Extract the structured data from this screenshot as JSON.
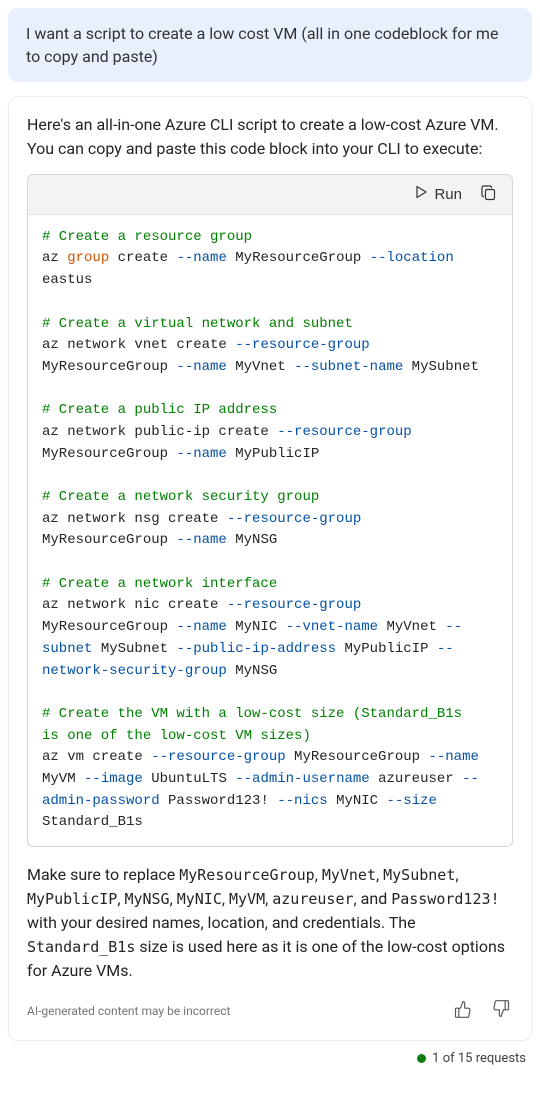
{
  "userMessage": "I want a script to create a low cost VM (all in one codeblock for me to copy and paste)",
  "responseIntro": "Here's an all-in-one Azure CLI script to create a low-cost Azure VM. You can copy and paste this code block into your CLI to execute:",
  "toolbar": {
    "runLabel": "Run"
  },
  "code": {
    "lines": [
      [
        {
          "t": "comment",
          "v": "# Create a resource group"
        }
      ],
      [
        {
          "t": "plain",
          "v": "az "
        },
        {
          "t": "keyword",
          "v": "group"
        },
        {
          "t": "plain",
          "v": " create "
        },
        {
          "t": "flag",
          "v": "--name"
        },
        {
          "t": "plain",
          "v": " MyResourceGroup "
        },
        {
          "t": "flag",
          "v": "--location"
        },
        {
          "t": "plain",
          "v": " "
        }
      ],
      [
        {
          "t": "plain",
          "v": "eastus"
        }
      ],
      [],
      [
        {
          "t": "comment",
          "v": "# Create a virtual network and subnet"
        }
      ],
      [
        {
          "t": "plain",
          "v": "az network vnet create "
        },
        {
          "t": "flag",
          "v": "--resource-group"
        },
        {
          "t": "plain",
          "v": " "
        }
      ],
      [
        {
          "t": "plain",
          "v": "MyResourceGroup "
        },
        {
          "t": "flag",
          "v": "--name"
        },
        {
          "t": "plain",
          "v": " MyVnet "
        },
        {
          "t": "flag",
          "v": "--subnet-name"
        },
        {
          "t": "plain",
          "v": " MySubnet"
        }
      ],
      [],
      [
        {
          "t": "comment",
          "v": "# Create a public IP address"
        }
      ],
      [
        {
          "t": "plain",
          "v": "az network public-ip create "
        },
        {
          "t": "flag",
          "v": "--resource-group"
        },
        {
          "t": "plain",
          "v": " "
        }
      ],
      [
        {
          "t": "plain",
          "v": "MyResourceGroup "
        },
        {
          "t": "flag",
          "v": "--name"
        },
        {
          "t": "plain",
          "v": " MyPublicIP"
        }
      ],
      [],
      [
        {
          "t": "comment",
          "v": "# Create a network security group"
        }
      ],
      [
        {
          "t": "plain",
          "v": "az network nsg create "
        },
        {
          "t": "flag",
          "v": "--resource-group"
        },
        {
          "t": "plain",
          "v": " "
        }
      ],
      [
        {
          "t": "plain",
          "v": "MyResourceGroup "
        },
        {
          "t": "flag",
          "v": "--name"
        },
        {
          "t": "plain",
          "v": " MyNSG"
        }
      ],
      [],
      [
        {
          "t": "comment",
          "v": "# Create a network interface"
        }
      ],
      [
        {
          "t": "plain",
          "v": "az network nic create "
        },
        {
          "t": "flag",
          "v": "--resource-group"
        },
        {
          "t": "plain",
          "v": " "
        }
      ],
      [
        {
          "t": "plain",
          "v": "MyResourceGroup "
        },
        {
          "t": "flag",
          "v": "--name"
        },
        {
          "t": "plain",
          "v": " MyNIC "
        },
        {
          "t": "flag",
          "v": "--vnet-name"
        },
        {
          "t": "plain",
          "v": " MyVnet "
        },
        {
          "t": "flag",
          "v": "--"
        }
      ],
      [
        {
          "t": "flag",
          "v": "subnet"
        },
        {
          "t": "plain",
          "v": " MySubnet "
        },
        {
          "t": "flag",
          "v": "--public-ip-address"
        },
        {
          "t": "plain",
          "v": " MyPublicIP "
        },
        {
          "t": "flag",
          "v": "--"
        }
      ],
      [
        {
          "t": "flag",
          "v": "network-security-group"
        },
        {
          "t": "plain",
          "v": " MyNSG"
        }
      ],
      [],
      [
        {
          "t": "comment",
          "v": "# Create the VM with a low-cost size (Standard_B1s "
        }
      ],
      [
        {
          "t": "comment",
          "v": "is one of the low-cost VM sizes)"
        }
      ],
      [
        {
          "t": "plain",
          "v": "az vm create "
        },
        {
          "t": "flag",
          "v": "--resource-group"
        },
        {
          "t": "plain",
          "v": " MyResourceGroup "
        },
        {
          "t": "flag",
          "v": "--name"
        },
        {
          "t": "plain",
          "v": " "
        }
      ],
      [
        {
          "t": "plain",
          "v": "MyVM "
        },
        {
          "t": "flag",
          "v": "--image"
        },
        {
          "t": "plain",
          "v": " UbuntuLTS "
        },
        {
          "t": "flag",
          "v": "--admin-username"
        },
        {
          "t": "plain",
          "v": " azureuser "
        },
        {
          "t": "flag",
          "v": "--"
        }
      ],
      [
        {
          "t": "flag",
          "v": "admin-password"
        },
        {
          "t": "plain",
          "v": " Password123! "
        },
        {
          "t": "flag",
          "v": "--nics"
        },
        {
          "t": "plain",
          "v": " MyNIC "
        },
        {
          "t": "flag",
          "v": "--size"
        },
        {
          "t": "plain",
          "v": " "
        }
      ],
      [
        {
          "t": "plain",
          "v": "Standard_B1s"
        }
      ]
    ]
  },
  "responseOutro": {
    "parts": [
      {
        "t": "text",
        "v": "Make sure to replace "
      },
      {
        "t": "code",
        "v": "MyResourceGroup"
      },
      {
        "t": "text",
        "v": ", "
      },
      {
        "t": "code",
        "v": "MyVnet"
      },
      {
        "t": "text",
        "v": ", "
      },
      {
        "t": "code",
        "v": "MySubnet"
      },
      {
        "t": "text",
        "v": ", "
      },
      {
        "t": "code",
        "v": "MyPublicIP"
      },
      {
        "t": "text",
        "v": ", "
      },
      {
        "t": "code",
        "v": "MyNSG"
      },
      {
        "t": "text",
        "v": ", "
      },
      {
        "t": "code",
        "v": "MyNIC"
      },
      {
        "t": "text",
        "v": ", "
      },
      {
        "t": "code",
        "v": "MyVM"
      },
      {
        "t": "text",
        "v": ", "
      },
      {
        "t": "code",
        "v": "azureuser"
      },
      {
        "t": "text",
        "v": ", and "
      },
      {
        "t": "code",
        "v": "Password123!"
      },
      {
        "t": "text",
        "v": " with your desired names, location, and credentials. The "
      },
      {
        "t": "code",
        "v": "Standard_B1s"
      },
      {
        "t": "text",
        "v": " size is used here as it is one of the low-cost options for Azure VMs."
      }
    ]
  },
  "footer": {
    "disclaimer": "AI-generated content may be incorrect",
    "requests": "1 of 15 requests"
  }
}
